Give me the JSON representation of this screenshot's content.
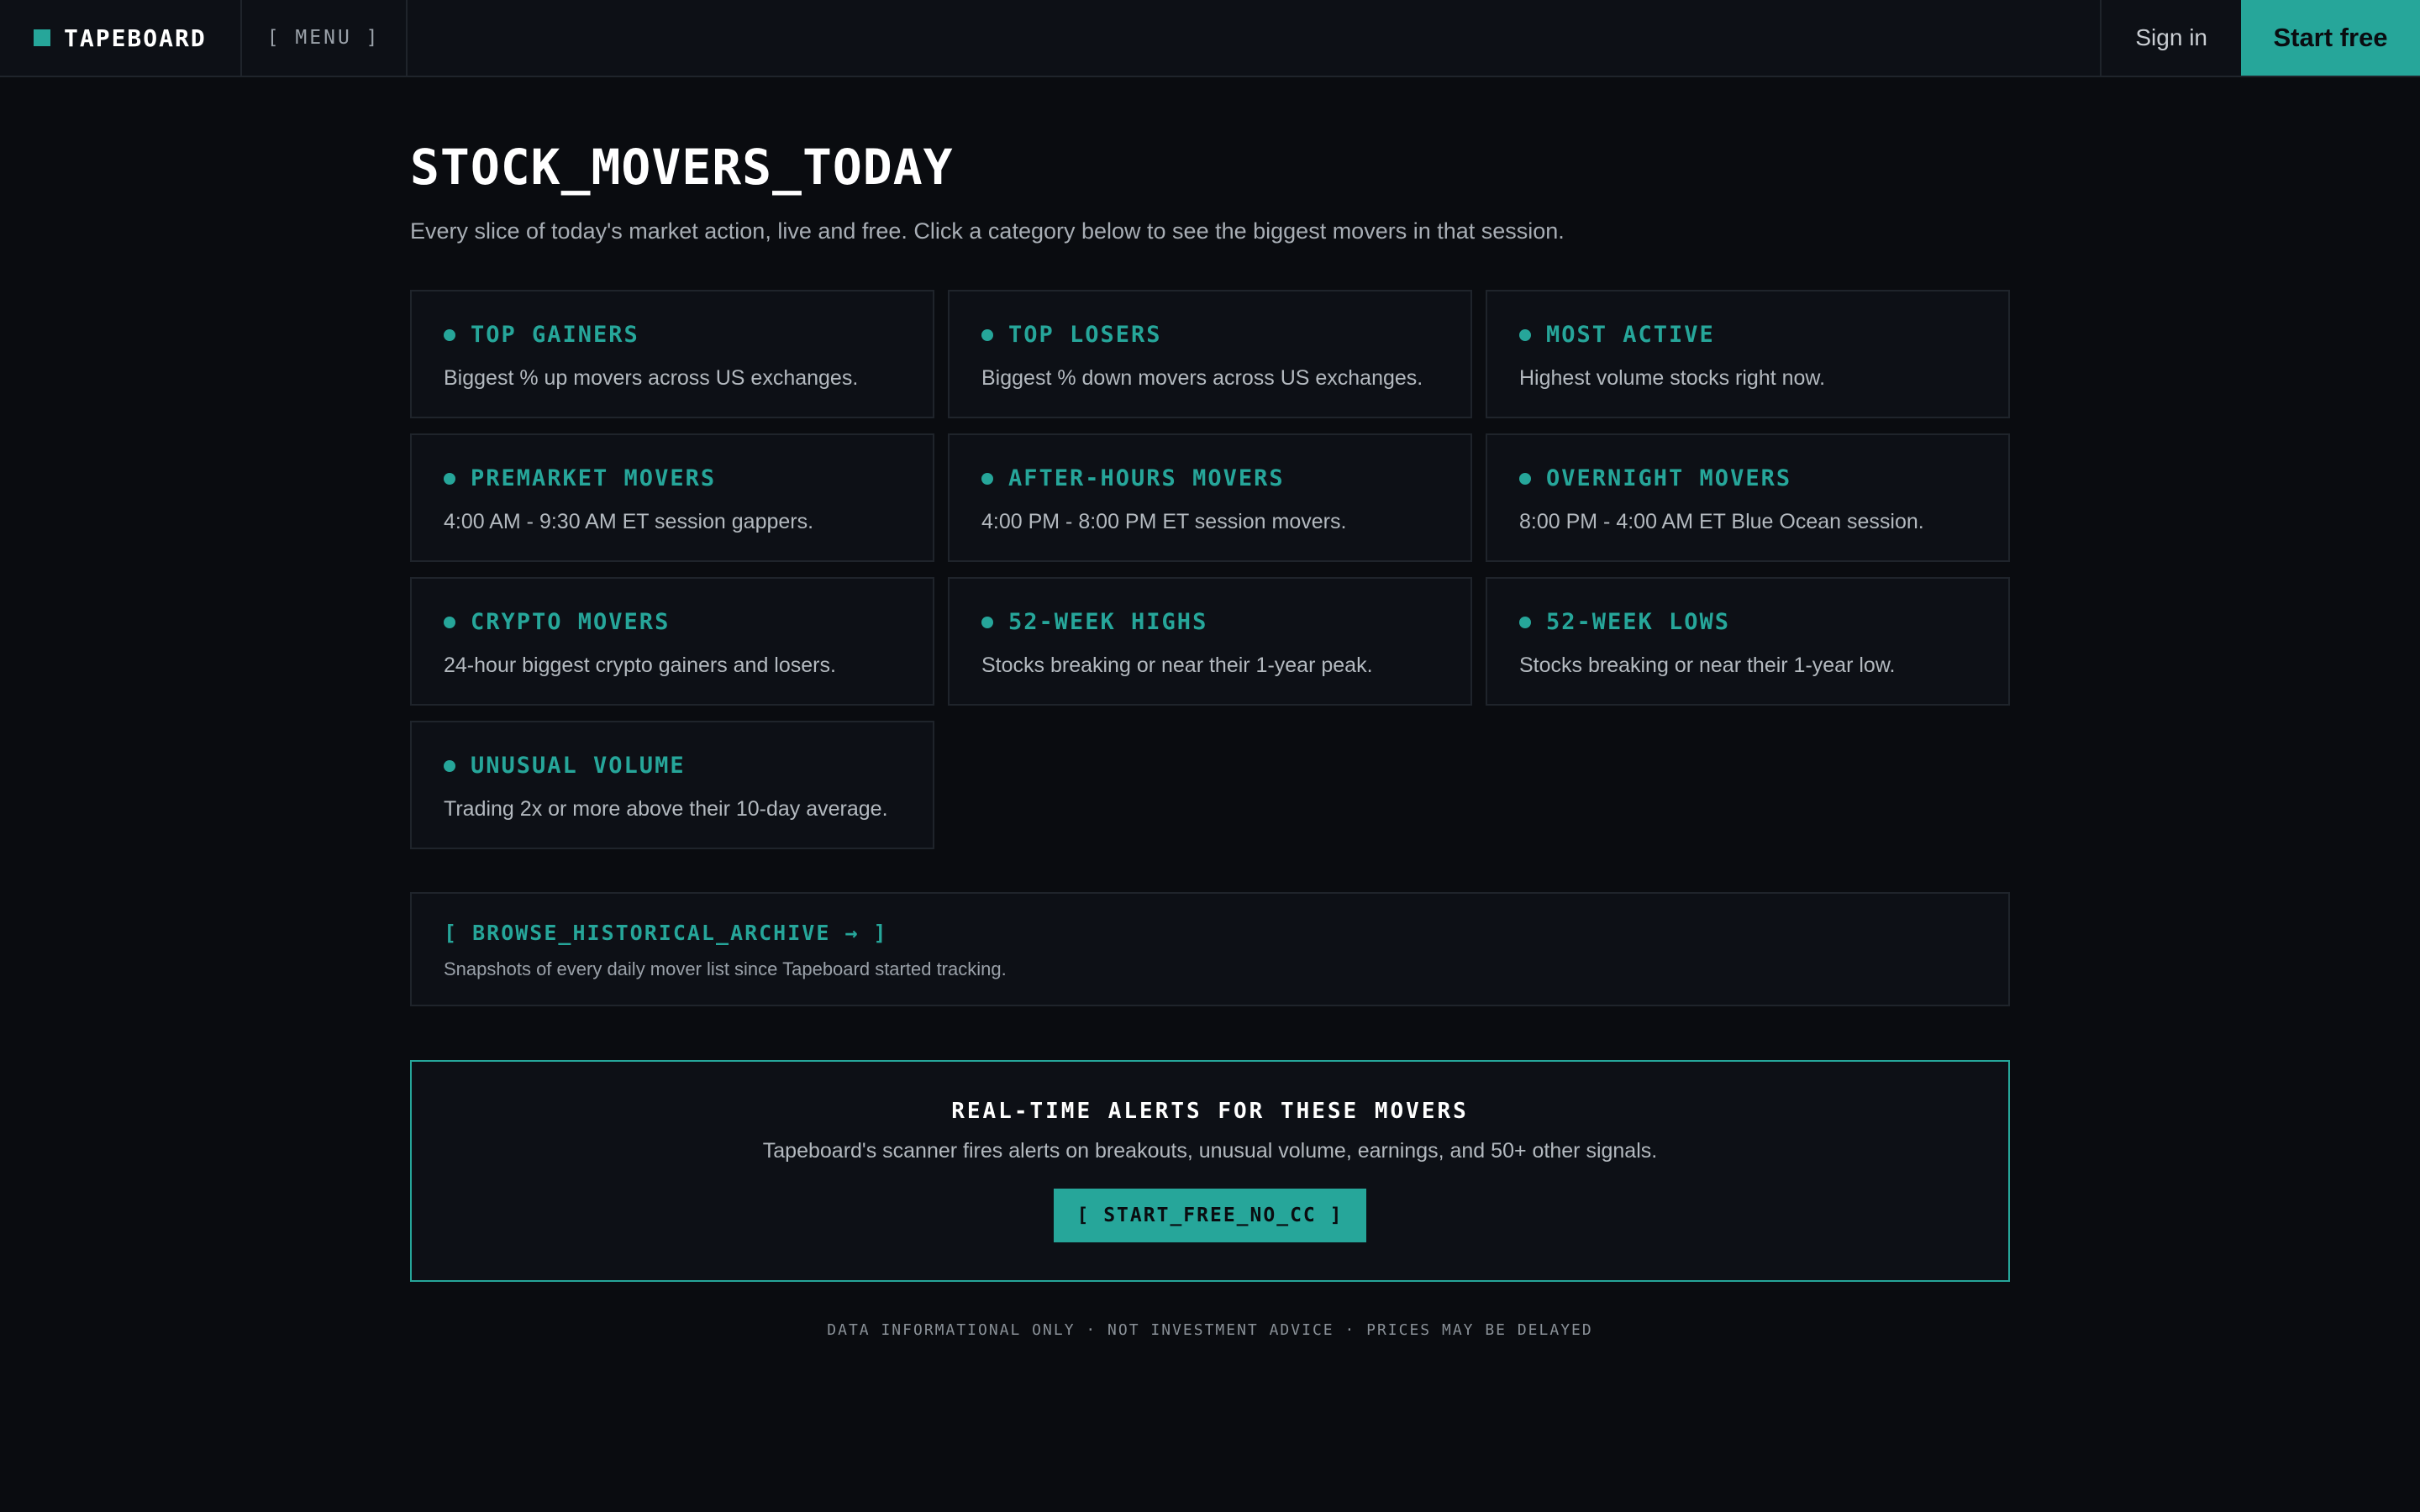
{
  "header": {
    "brand": "TAPEBOARD",
    "menu_label": "[ MENU ]",
    "signin_label": "Sign in",
    "start_label": "Start free"
  },
  "page": {
    "title": "STOCK_MOVERS_TODAY",
    "subtitle": "Every slice of today's market action, live and free. Click a category below to see the biggest movers in that session."
  },
  "categories": [
    {
      "title": "TOP GAINERS",
      "desc": "Biggest % up movers across US exchanges."
    },
    {
      "title": "TOP LOSERS",
      "desc": "Biggest % down movers across US exchanges."
    },
    {
      "title": "MOST ACTIVE",
      "desc": "Highest volume stocks right now."
    },
    {
      "title": "PREMARKET MOVERS",
      "desc": "4:00 AM - 9:30 AM ET session gappers."
    },
    {
      "title": "AFTER-HOURS MOVERS",
      "desc": "4:00 PM - 8:00 PM ET session movers."
    },
    {
      "title": "OVERNIGHT MOVERS",
      "desc": "8:00 PM - 4:00 AM ET Blue Ocean session."
    },
    {
      "title": "CRYPTO MOVERS",
      "desc": "24-hour biggest crypto gainers and losers."
    },
    {
      "title": "52-WEEK HIGHS",
      "desc": "Stocks breaking or near their 1-year peak."
    },
    {
      "title": "52-WEEK LOWS",
      "desc": "Stocks breaking or near their 1-year low."
    },
    {
      "title": "UNUSUAL VOLUME",
      "desc": "Trading 2x or more above their 10-day average."
    }
  ],
  "archive": {
    "link_label": "[ BROWSE_HISTORICAL_ARCHIVE → ]",
    "desc": "Snapshots of every daily mover list since Tapeboard started tracking."
  },
  "cta": {
    "title": "REAL-TIME ALERTS FOR THESE MOVERS",
    "desc": "Tapeboard's scanner fires alerts on breakouts, unusual volume, earnings, and 50+ other signals.",
    "button_label": "[ START_FREE_NO_CC ]"
  },
  "disclaimer": "DATA INFORMATIONAL ONLY · NOT INVESTMENT ADVICE · PRICES MAY BE DELAYED",
  "colors": {
    "accent": "#26a69a",
    "background": "#0a0c10",
    "panel": "#0d1016",
    "border": "#1f242b"
  }
}
